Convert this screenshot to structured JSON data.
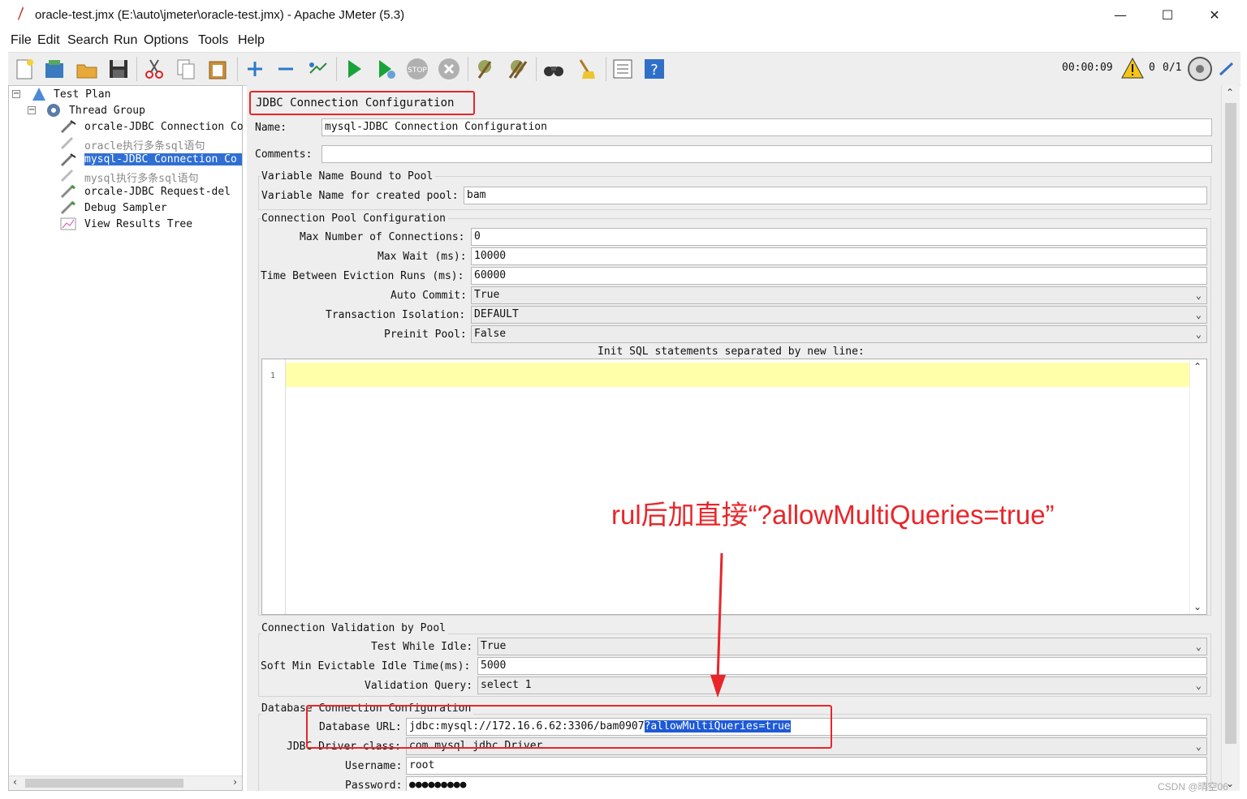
{
  "window": {
    "title": "oracle-test.jmx (E:\\auto\\jmeter\\oracle-test.jmx) - Apache JMeter (5.3)"
  },
  "menu": {
    "file": "File",
    "edit": "Edit",
    "search": "Search",
    "run": "Run",
    "options": "Options",
    "tools": "Tools",
    "help": "Help"
  },
  "toolbar": {
    "timer": "00:00:09",
    "warnings": "0",
    "threads": "0/1"
  },
  "tree": {
    "test_plan": "Test Plan",
    "thread_group": "Thread Group",
    "items": [
      {
        "label": "orcale-JDBC Connection Co"
      },
      {
        "label": "oracle执行多条sql语句"
      },
      {
        "label": "mysql-JDBC Connection Co"
      },
      {
        "label": "mysql执行多条sql语句"
      },
      {
        "label": "orcale-JDBC Request-del"
      },
      {
        "label": "Debug Sampler"
      },
      {
        "label": "View Results Tree"
      }
    ]
  },
  "panel": {
    "title": "JDBC Connection Configuration",
    "name_label": "Name:",
    "name_value": "mysql-JDBC Connection Configuration",
    "comments_label": "Comments:",
    "comments_value": "",
    "var_group": "Variable Name Bound to Pool",
    "var_label": "Variable Name for created pool:",
    "var_value": "bam",
    "pool_group": "Connection Pool Configuration",
    "max_conn_label": "Max Number of Connections:",
    "max_conn_value": "0",
    "max_wait_label": "Max Wait (ms):",
    "max_wait_value": "10000",
    "eviction_label": "Time Between Eviction Runs (ms):",
    "eviction_value": "60000",
    "auto_commit_label": "Auto Commit:",
    "auto_commit_value": "True",
    "isolation_label": "Transaction Isolation:",
    "isolation_value": "DEFAULT",
    "preinit_label": "Preinit Pool:",
    "preinit_value": "False",
    "init_sql_label": "Init SQL statements separated by new line:",
    "line_no": "1",
    "validation_group": "Connection Validation by Pool",
    "test_idle_label": "Test While Idle:",
    "test_idle_value": "True",
    "soft_min_label": "Soft Min Evictable Idle Time(ms):",
    "soft_min_value": "5000",
    "validation_query_label": "Validation Query:",
    "validation_query_value": "select 1",
    "db_group": "Database Connection Configuration",
    "db_url_label": "Database URL:",
    "db_url_value": "jdbc:mysql://172.16.6.62:3306/bam0907",
    "db_url_selected": "?allowMultiQueries=true",
    "driver_label": "JDBC Driver class:",
    "driver_value": "com.mysql.jdbc.Driver",
    "username_label": "Username:",
    "username_value": "root",
    "password_label": "Password:",
    "password_value": "●●●●●●●●●"
  },
  "annotation": "rul后加直接“?allowMultiQueries=true”",
  "watermark": "CSDN @晴空06",
  "colors": {
    "accent_red": "#e8262a",
    "selection_blue": "#2f6fd3",
    "highlight_yellow": "#ffffaa"
  }
}
